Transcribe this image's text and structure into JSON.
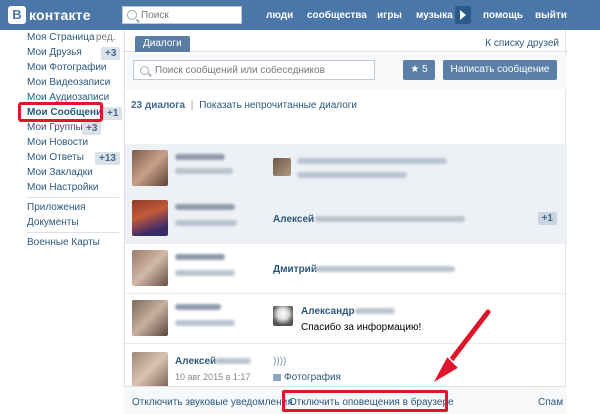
{
  "header": {
    "logo_letter": "В",
    "logo_text": "контакте",
    "search_placeholder": "Поиск",
    "nav": [
      "люди",
      "сообщества",
      "игры",
      "музыка",
      "помощь",
      "выйти"
    ]
  },
  "leftmenu": {
    "items": [
      {
        "label": "Моя Страница",
        "extra": "ред."
      },
      {
        "label": "Мои Друзья",
        "badge": "+3"
      },
      {
        "label": "Мои Фотографии"
      },
      {
        "label": "Мои Видеозаписи"
      },
      {
        "label": "Мои Аудиозаписи"
      },
      {
        "label": "Мои Сообщения",
        "badge": "+1"
      },
      {
        "label": "Мои Группы",
        "badge": "+3"
      },
      {
        "label": "Мои Новости"
      },
      {
        "label": "Мои Ответы",
        "badge": "+13"
      },
      {
        "label": "Мои Закладки"
      },
      {
        "label": "Мои Настройки"
      },
      {
        "label": "Приложения"
      },
      {
        "label": "Документы"
      },
      {
        "label": "Военные Карты"
      }
    ]
  },
  "main": {
    "tab_dialogs": "Диалоги",
    "to_friends": "К списку друзей",
    "search_placeholder": "Поиск сообщений или собеседников",
    "star_count": "5",
    "write_button": "Написать сообщение",
    "dialog_count": "23 диалога",
    "show_unread": "Показать непрочитанные диалоги",
    "rows": [
      {
        "unread": true
      },
      {
        "unread": true,
        "name": "Алексей",
        "badge": "+1"
      },
      {
        "unread": false,
        "name": "Дмитрий"
      },
      {
        "unread": false,
        "name": "Александр",
        "text": "Спасибо за информацию!"
      },
      {
        "unread": false,
        "name": "Алексей",
        "date": "10 авг 2015 в 1:17",
        "wave": "))))",
        "attach": "Фотография"
      }
    ]
  },
  "footer": {
    "sound_off": "Отключить звуковые уведомления",
    "browser_off": "Отключить оповещения в браузере",
    "spam": "Спам"
  },
  "colors": {
    "brand": "#4a76a8",
    "highlight": "#e0142a"
  }
}
